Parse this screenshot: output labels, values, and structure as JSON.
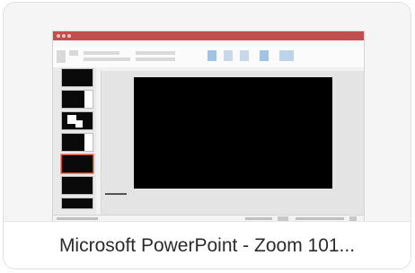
{
  "card": {
    "caption": "Microsoft PowerPoint - Zoom 101..."
  },
  "colors": {
    "powerpoint_accent": "#c0504d",
    "slide_background": "#000000",
    "selected_thumb_outline": "#d24726"
  },
  "thumbnail": {
    "selected_slide_index": 5,
    "slide_count_visible": 7
  }
}
